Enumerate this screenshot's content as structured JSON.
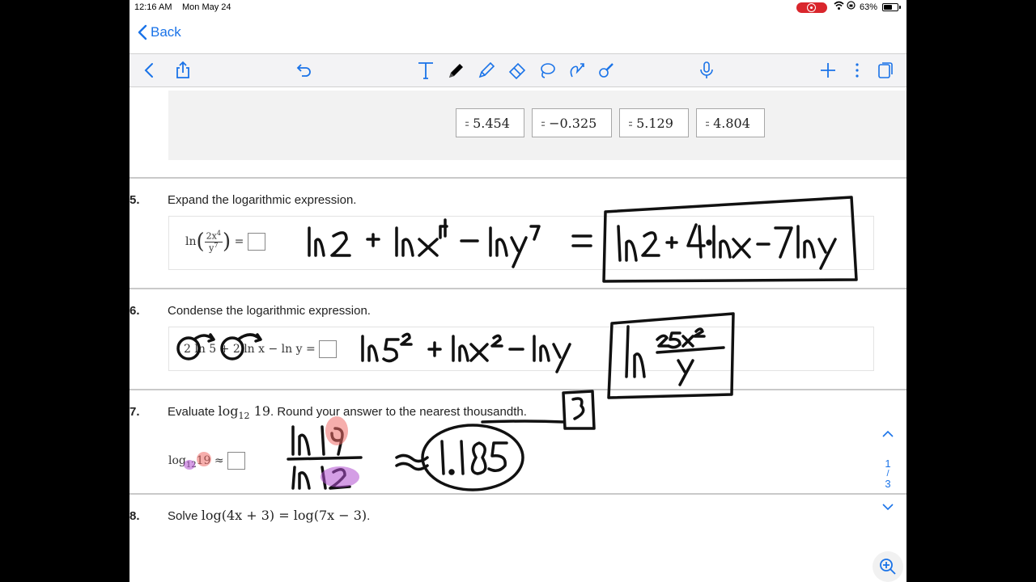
{
  "status_bar": {
    "time": "12:16 AM",
    "date": "Mon May 24",
    "battery": "63%",
    "battery_level": 0.63
  },
  "nav": {
    "back_label": "Back"
  },
  "toolbar": {
    "icons": [
      "chevron-left-icon",
      "share-icon",
      "undo-icon",
      "text-tool-icon",
      "pen-icon",
      "highlighter-icon",
      "eraser-icon",
      "lasso-icon",
      "shapes-icon",
      "pencil-tool-icon",
      "microphone-icon",
      "add-icon",
      "more-icon",
      "pages-icon"
    ]
  },
  "answer_chips": [
    "5.454",
    "−0.325",
    "5.129",
    "4.804"
  ],
  "questions": [
    {
      "number": "5.",
      "prompt": "Expand the logarithmic expression.",
      "lhs_fn": "ln",
      "frac_num": "2x",
      "frac_num_exp": "4",
      "frac_den": "y",
      "frac_den_exp": "7",
      "equals": "="
    },
    {
      "number": "6.",
      "prompt": "Condense the logarithmic expression.",
      "expression": "2 ln 5 + 2 ln x − ln y ="
    },
    {
      "number": "7.",
      "prompt_before": "Evaluate ",
      "prompt_math": "log",
      "prompt_sub": "12",
      "prompt_arg": " 19",
      "prompt_after": ". Round your answer to the nearest thousandth.",
      "lhs": "log",
      "lhs_sub": "12",
      "lhs_arg": "19 ≈"
    },
    {
      "number": "8.",
      "prompt_before": "Solve ",
      "prompt_math": "log(4x + 3) = log(7x − 3)",
      "prompt_after": "."
    }
  ],
  "side_nav": {
    "up": "^",
    "page": "1",
    "sep": "/",
    "total": "3",
    "down": "v"
  }
}
